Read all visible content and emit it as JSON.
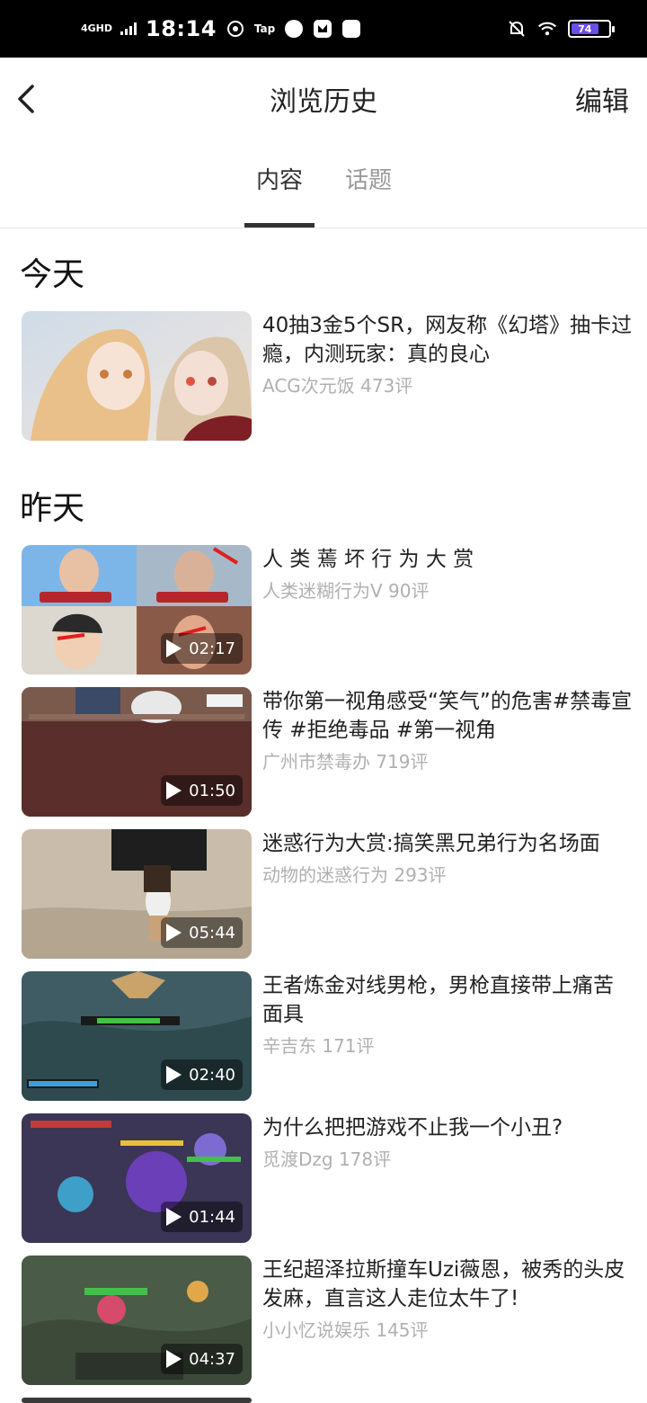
{
  "status_bar": {
    "network": "4GHD",
    "time": "18:14",
    "tap_label": "Tap",
    "battery": "74"
  },
  "header": {
    "title": "浏览历史",
    "edit_label": "编辑"
  },
  "tabs": [
    {
      "label": "内容"
    },
    {
      "label": "话题"
    }
  ],
  "sections": [
    {
      "title": "今天",
      "items": [
        {
          "title": "40抽3金5个SR，网友称《幻塔》抽卡过瘾，内测玩家：真的良心",
          "meta": "ACG次元饭 473评",
          "duration": ""
        }
      ]
    },
    {
      "title": "昨天",
      "items": [
        {
          "title": "人 类 蔫 坏 行 为 大 赏",
          "meta": "人类迷糊行为V 90评",
          "duration": "02:17"
        },
        {
          "title": "带你第一视角感受“笑气”的危害#禁毒宣传 #拒绝毒品 #第一视角",
          "meta": "广州市禁毒办 719评",
          "duration": "01:50"
        },
        {
          "title": "迷惑行为大赏:搞笑黑兄弟行为名场面",
          "meta": "动物的迷惑行为 293评",
          "duration": "05:44"
        },
        {
          "title": "王者炼金对线男枪，男枪直接带上痛苦面具",
          "meta": "辛吉东 171评",
          "duration": "02:40"
        },
        {
          "title": "为什么把把游戏不止我一个小丑?",
          "meta": "觅渡Dzg 178评",
          "duration": "01:44"
        },
        {
          "title": "王纪超泽拉斯撞车Uzi薇恩，被秀的头皮发麻，直言这人走位太牛了!",
          "meta": "小小忆说娱乐 145评",
          "duration": "04:37"
        }
      ]
    }
  ]
}
